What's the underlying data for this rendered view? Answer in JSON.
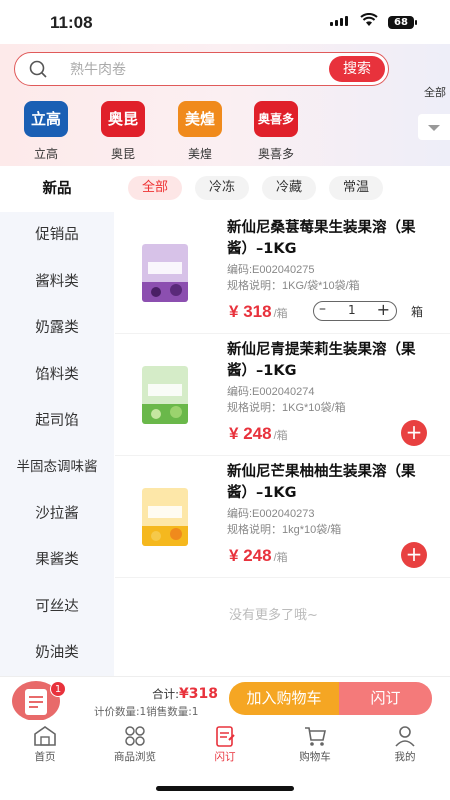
{
  "status": {
    "time": "11:08",
    "battery": "68"
  },
  "search": {
    "placeholder": "熟牛肉卷",
    "button": "搜索"
  },
  "brands": [
    {
      "logo": "立高",
      "label": "立高",
      "color": "#1a5fb4"
    },
    {
      "logo": "奥昆",
      "label": "奥昆",
      "color": "#e0202a"
    },
    {
      "logo": "美煌",
      "label": "美煌",
      "color": "#f08a1c"
    },
    {
      "logo": "奥喜多",
      "label": "奥喜多",
      "color": "#e0202a"
    }
  ],
  "all_categories": "全部",
  "sidebar": [
    "新品",
    "促销品",
    "酱料类",
    "奶露类",
    "馅料类",
    "起司馅",
    "半固态调味酱",
    "沙拉酱",
    "果酱类",
    "可丝达",
    "奶油类"
  ],
  "filters": [
    "全部",
    "冷冻",
    "冷藏",
    "常温"
  ],
  "products": [
    {
      "name": "新仙尼桑葚莓果生装果溶（果酱）–1KG",
      "code": "编码:E002040275",
      "spec": "规格说明：1KG/袋*10袋/箱",
      "price": "318",
      "unit": "/箱",
      "qty": "1",
      "box": "箱",
      "img_color": "#8c4fb0",
      "img_label": "桑葚莓果"
    },
    {
      "name": "新仙尼青提茉莉生装果溶（果酱）–1KG",
      "code": "编码:E002040274",
      "spec": "规格说明：1KG*10袋/箱",
      "price": "248",
      "unit": "/箱",
      "img_color": "#6ab84a",
      "img_label": "青提茉莉"
    },
    {
      "name": "新仙尼芒果柚柚生装果溶（果酱）–1KG",
      "code": "编码:E002040273",
      "spec": "规格说明：1kg*10袋/箱",
      "price": "248",
      "unit": "/箱",
      "img_color": "#f5b81e",
      "img_label": "芒果柚柚"
    }
  ],
  "no_more": "没有更多了哦~",
  "cart": {
    "badge": "1",
    "total_label": "合计:",
    "total_value": "¥318",
    "counts": "计价数量:1销售数量:1",
    "add_button": "加入购物车",
    "flash_button": "闪订"
  },
  "tabs": [
    {
      "label": "首页",
      "icon": "home-icon"
    },
    {
      "label": "商品浏览",
      "icon": "grid-icon"
    },
    {
      "label": "闪订",
      "icon": "order-icon",
      "active": true
    },
    {
      "label": "购物车",
      "icon": "cart-icon"
    },
    {
      "label": "我的",
      "icon": "user-icon"
    }
  ]
}
